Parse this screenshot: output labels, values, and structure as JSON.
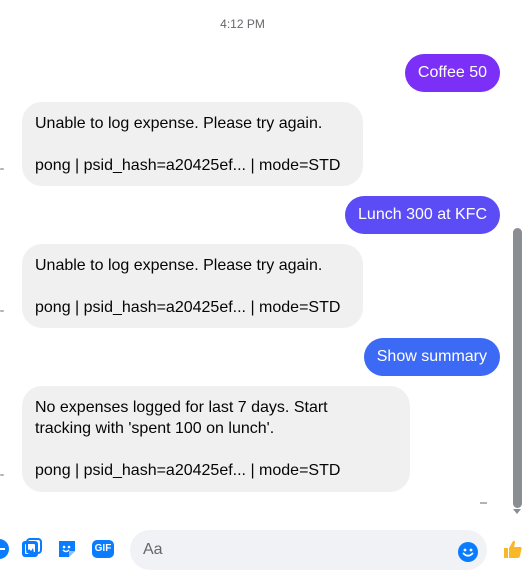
{
  "thread": {
    "timestamp": "4:12 PM",
    "messages": [
      {
        "direction": "outgoing",
        "text": "Coffee 50"
      },
      {
        "direction": "incoming",
        "lines": [
          "Unable to log expense. Please try again.",
          "",
          "pong | psid_hash=a20425ef... | mode=STD"
        ]
      },
      {
        "direction": "outgoing",
        "text": "Lunch 300 at KFC"
      },
      {
        "direction": "incoming",
        "lines": [
          "Unable to log expense. Please try again.",
          "",
          "pong | psid_hash=a20425ef... | mode=STD"
        ]
      },
      {
        "direction": "outgoing",
        "text": "Show summary"
      },
      {
        "direction": "incoming",
        "lines": [
          "No expenses logged for last 7 days. Start",
          "tracking with 'spent 100 on lunch'.",
          "",
          "pong | psid_hash=a20425ef... | mode=STD"
        ]
      }
    ]
  },
  "composer": {
    "placeholder": "Aa",
    "gif_label": "GIF",
    "icons": [
      "add-icon",
      "photo-icon",
      "sticker-icon",
      "gif-icon",
      "emoji-icon",
      "thumbs-up-icon"
    ]
  },
  "colors": {
    "outgoing_1": "#7b2ff7",
    "outgoing_2": "#5b4cf5",
    "outgoing_3": "#3d6af5",
    "incoming_bg": "#f0f0f0",
    "accent": "#0a7cff"
  }
}
